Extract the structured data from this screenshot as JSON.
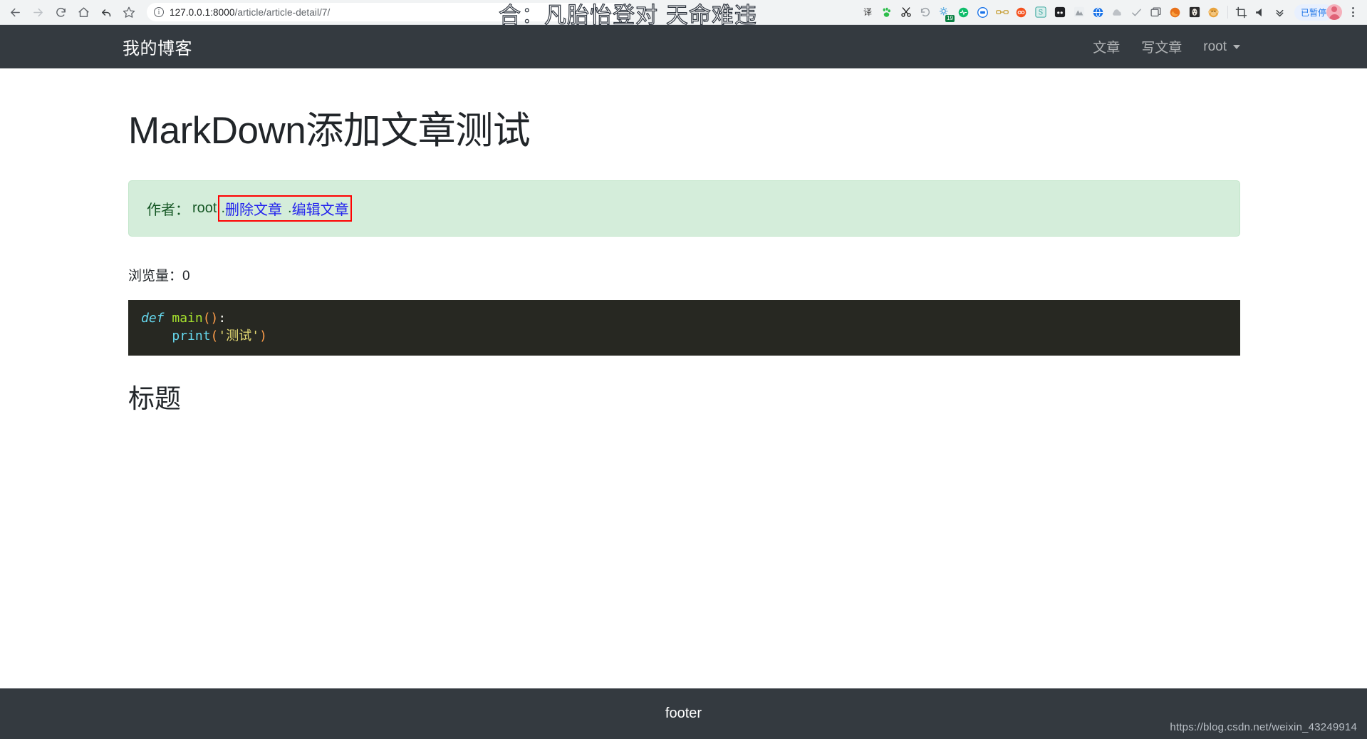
{
  "browser": {
    "back_title": "back-arrow",
    "forward_title": "forward-arrow",
    "reload_title": "reload",
    "home_title": "home",
    "undo_title": "undo",
    "bookmark_title": "star",
    "url_prefix": "127.0.0.1:8000",
    "url_path": "/article/article-detail/7/",
    "url_full": "127.0.0.1:8000/article/article-detail/7/",
    "paused_label": "已暂停",
    "extensions": [
      {
        "name": "youdao-dict-icon",
        "glyph": "译",
        "color": "#3a3a3a"
      },
      {
        "name": "baidu-paw-icon",
        "glyph": "🐾",
        "color": "#2cbd4a"
      },
      {
        "name": "scissors-icon",
        "glyph": "✂",
        "color": "#1a1a1a"
      },
      {
        "name": "history-undo-icon",
        "glyph": "↺",
        "color": "#9aa0a6"
      },
      {
        "name": "gear-badge-icon",
        "glyph": "⚙",
        "color": "#4aa3df",
        "badge": "19"
      },
      {
        "name": "green-wave-icon",
        "glyph": "◉",
        "color": "#0fbd6b"
      },
      {
        "name": "blue-circle-icon",
        "glyph": "◎",
        "color": "#1a73e8"
      },
      {
        "name": "glasses-icon",
        "glyph": "👓",
        "color": "#c8a23c"
      },
      {
        "name": "infinity-orange-icon",
        "glyph": "∞",
        "color": "#f4511e"
      },
      {
        "name": "letter-s-icon",
        "glyph": "S",
        "color": "#3fa9a0"
      },
      {
        "name": "dark-dots-icon",
        "glyph": "••",
        "color": "#202124"
      },
      {
        "name": "grey-mountain-icon",
        "glyph": "⛰",
        "color": "#9aa0a6"
      },
      {
        "name": "globe-blue-icon",
        "glyph": "🌐",
        "color": "#1a73e8"
      },
      {
        "name": "cloud-upload-icon",
        "glyph": "☁",
        "color": "#bdc1c6"
      },
      {
        "name": "checkmark-icon",
        "glyph": "✓",
        "color": "#9aa0a6"
      },
      {
        "name": "window-copy-icon",
        "glyph": "❐",
        "color": "#5f6368"
      },
      {
        "name": "firefox-face-icon",
        "glyph": "●",
        "color": "#e8711a"
      },
      {
        "name": "noface-mask-icon",
        "glyph": "☻",
        "color": "#2b2b2b"
      },
      {
        "name": "monkey-face-icon",
        "glyph": "●",
        "color": "#e8a33d"
      }
    ],
    "tail_icons": [
      {
        "name": "crop-icon",
        "glyph": "⌗",
        "color": "#3c4043"
      },
      {
        "name": "volume-icon",
        "glyph": "◀",
        "color": "#3c4043"
      },
      {
        "name": "chevrons-down-icon",
        "glyph": "⌄",
        "color": "#3c4043"
      }
    ]
  },
  "overlay": {
    "ime_text": "合：凡胎怡登对 天命难违"
  },
  "site_nav": {
    "brand": "我的博客",
    "links": [
      {
        "label": "文章",
        "name": "nav-link-articles"
      },
      {
        "label": "写文章",
        "name": "nav-link-write"
      }
    ],
    "user": "root"
  },
  "article": {
    "title": "MarkDown添加文章测试",
    "author_label": "作者：",
    "author_name": "root",
    "link_prefix_dot": ".",
    "delete_link": "删除文章",
    "edit_link": "编辑文章",
    "views_label": "浏览量：",
    "views_count": "0",
    "code": {
      "language": "python",
      "line1_kw": "def",
      "line1_fn": "main",
      "line1_parens": "()",
      "line1_colon": ":",
      "line2_indent": "    ",
      "line2_fn": "print",
      "line2_open": "(",
      "line2_str": "'测试'",
      "line2_close": ")"
    },
    "heading": "标题"
  },
  "footer": {
    "text": "footer",
    "watermark": "https://blog.csdn.net/weixin_43249914"
  },
  "colors": {
    "nav_bg": "#343a40",
    "alert_bg": "#d4edda",
    "alert_border": "#c3e6cb",
    "alert_text": "#155724",
    "link_blue": "#2222ee",
    "annotation_red": "#ff0000",
    "code_bg": "#272822",
    "accent_blue": "#1a73e8"
  }
}
